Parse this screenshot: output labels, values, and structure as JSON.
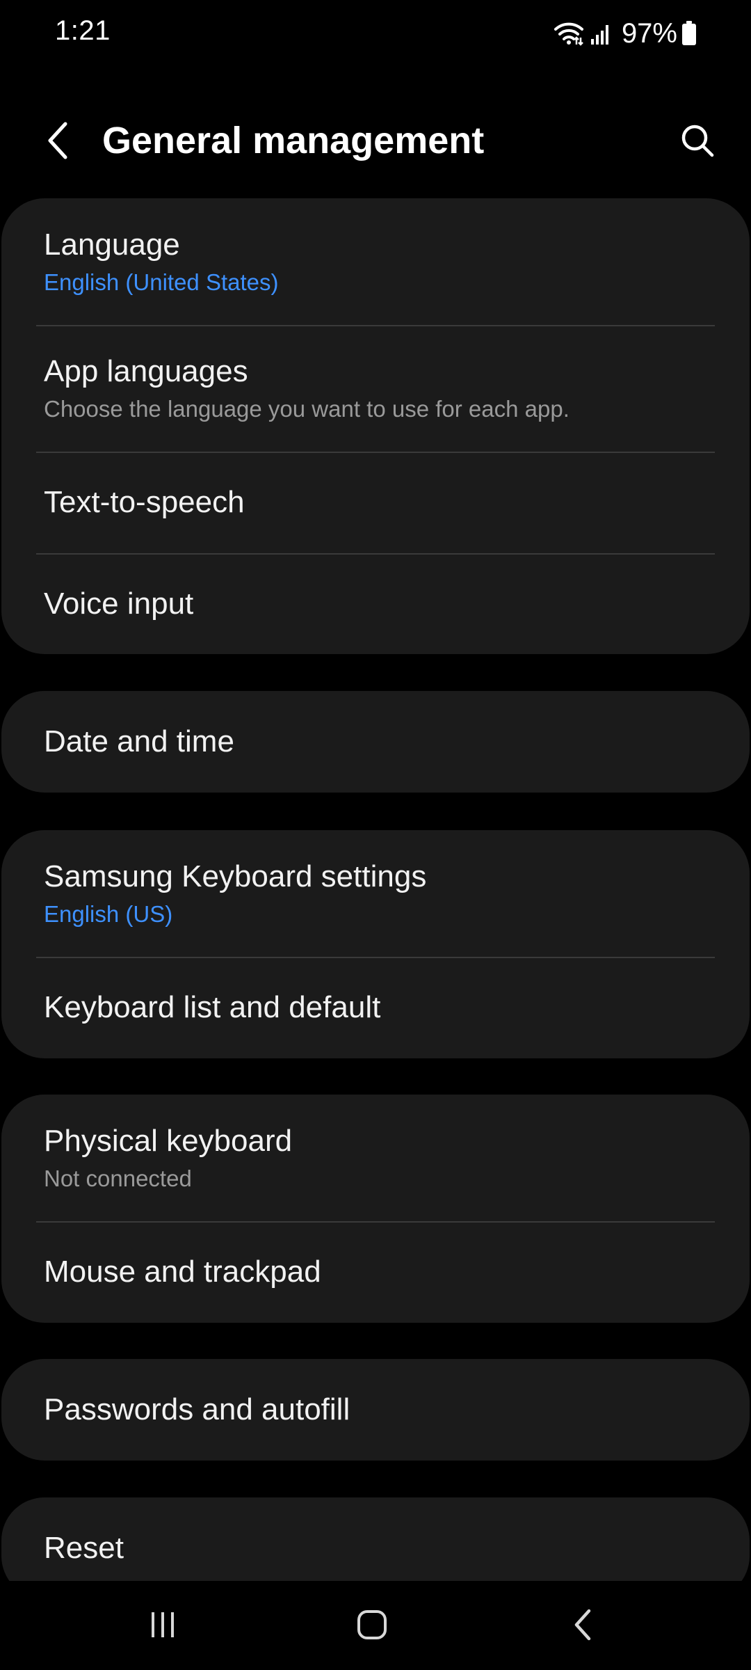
{
  "status_bar": {
    "time": "1:21",
    "battery": "97%",
    "icons": [
      "wifi-icon",
      "signal-icon",
      "battery-icon"
    ]
  },
  "header": {
    "title": "General management",
    "back_icon": "back-arrow-icon",
    "search_icon": "search-icon"
  },
  "colors": {
    "background": "#000000",
    "card": "#1b1b1b",
    "accent": "#3e91ff",
    "subtitle_gray": "#9a9a9a"
  },
  "groups": [
    {
      "items": [
        {
          "title": "Language",
          "subtitle": "English (United States)",
          "subtitle_style": "accent"
        },
        {
          "title": "App languages",
          "subtitle": "Choose the language you want to use for each app.",
          "subtitle_style": "gray"
        },
        {
          "title": "Text-to-speech"
        },
        {
          "title": "Voice input"
        }
      ]
    },
    {
      "items": [
        {
          "title": "Date and time"
        }
      ]
    },
    {
      "items": [
        {
          "title": "Samsung Keyboard settings",
          "subtitle": "English (US)",
          "subtitle_style": "accent"
        },
        {
          "title": "Keyboard list and default"
        }
      ]
    },
    {
      "items": [
        {
          "title": "Physical keyboard",
          "subtitle": "Not connected",
          "subtitle_style": "gray"
        },
        {
          "title": "Mouse and trackpad"
        }
      ]
    },
    {
      "items": [
        {
          "title": "Passwords and autofill"
        }
      ]
    },
    {
      "items": [
        {
          "title": "Reset"
        }
      ]
    }
  ],
  "nav_bar": {
    "icons": [
      "recents-icon",
      "home-icon",
      "back-icon"
    ]
  }
}
